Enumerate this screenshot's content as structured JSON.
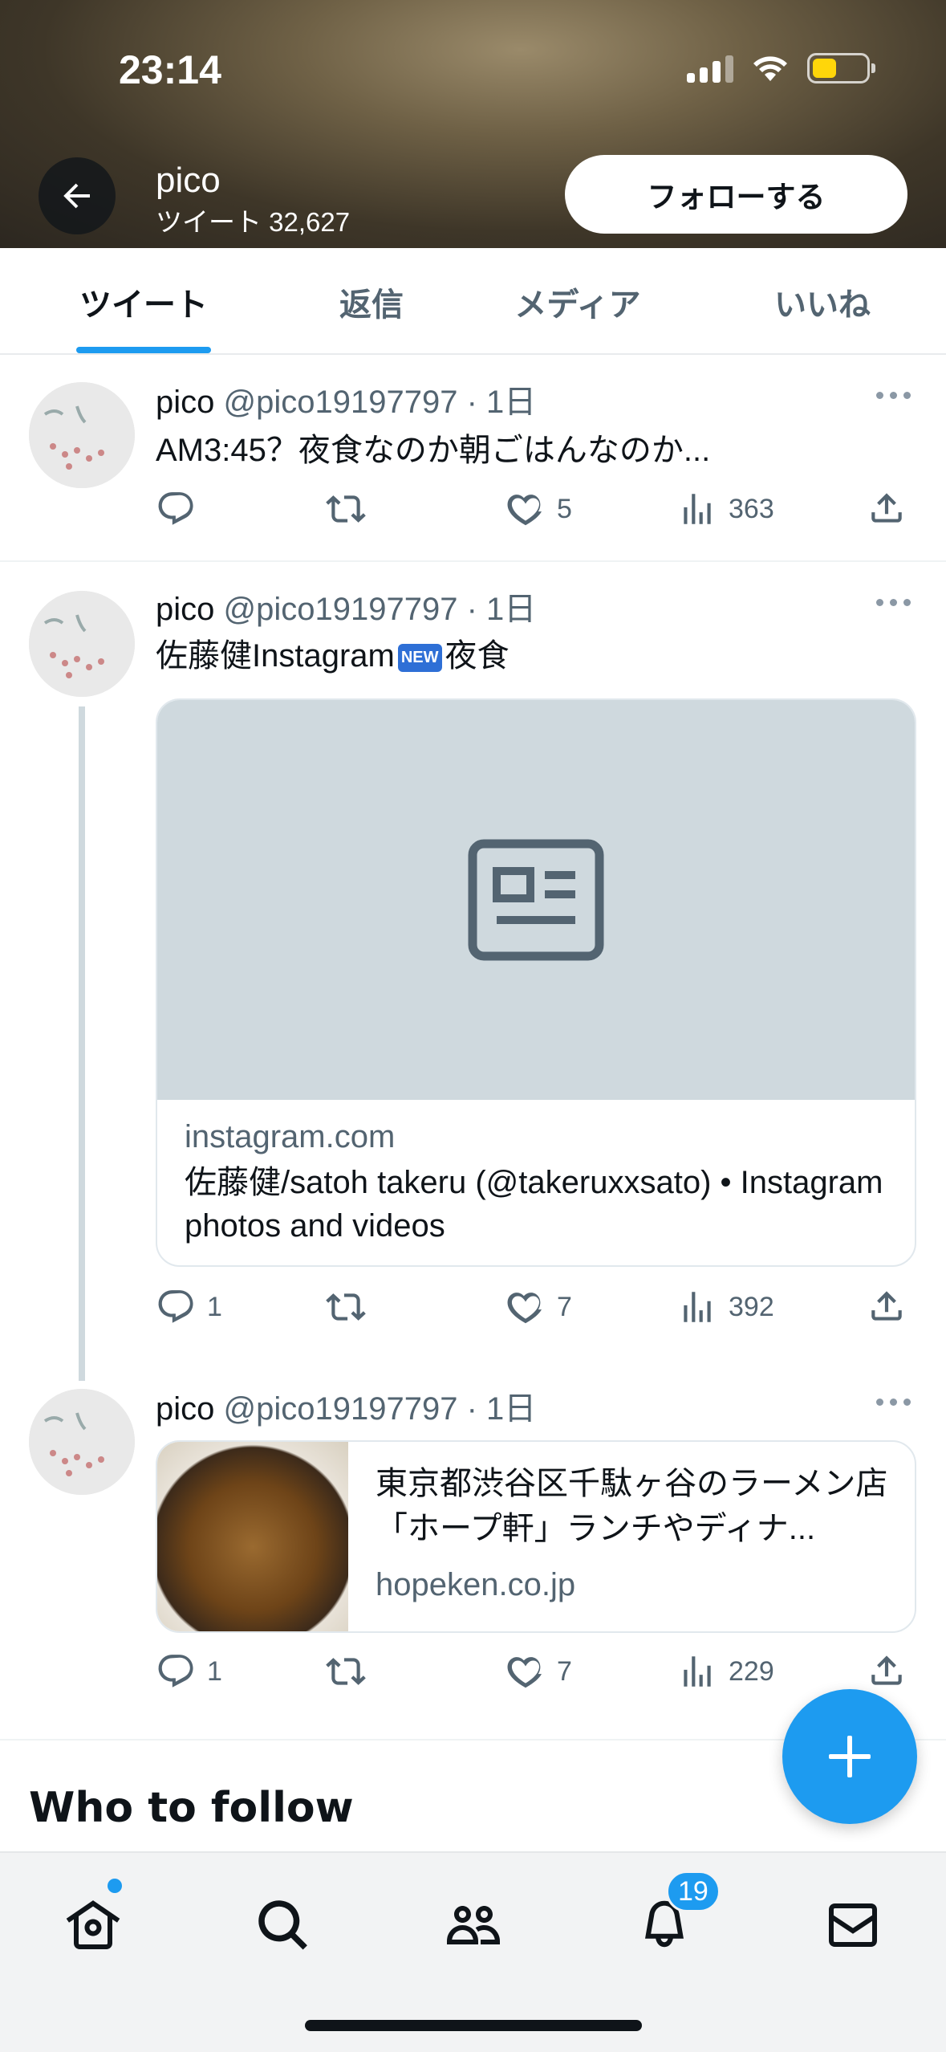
{
  "status_bar": {
    "time": "23:14"
  },
  "header": {
    "name": "pico",
    "tweet_count": "ツイート 32,627",
    "follow_label": "フォローする"
  },
  "tabs": [
    {
      "label": "ツイート",
      "active": true
    },
    {
      "label": "返信",
      "active": false
    },
    {
      "label": "メディア",
      "active": false
    },
    {
      "label": "いいね",
      "active": false
    }
  ],
  "tweets": [
    {
      "name": "pico",
      "handle": "@pico19197797",
      "time": "1日",
      "text": "AM3:45？夜食なのか朝ごはんなのか...",
      "replies": "",
      "likes": "5",
      "views": "363"
    },
    {
      "name": "pico",
      "handle": "@pico19197797",
      "time": "1日",
      "text_before": "佐藤健Instagram",
      "badge": "NEW",
      "text_after": "夜食",
      "card": {
        "domain": "instagram.com",
        "title": "佐藤健/satoh takeru (@takeruxxsato) • Instagram photos and videos"
      },
      "replies": "1",
      "likes": "7",
      "views": "392"
    },
    {
      "name": "pico",
      "handle": "@pico19197797",
      "time": "1日",
      "card": {
        "title": "東京都渋谷区千駄ヶ谷のラーメン店「ホープ軒」ランチやディナ...",
        "domain": "hopeken.co.jp"
      },
      "replies": "1",
      "likes": "7",
      "views": "229"
    }
  ],
  "who_to_follow": "Who to follow",
  "nav": {
    "notifications_badge": "19"
  },
  "colors": {
    "accent": "#1d9bf0",
    "secondary_text": "#536471"
  }
}
